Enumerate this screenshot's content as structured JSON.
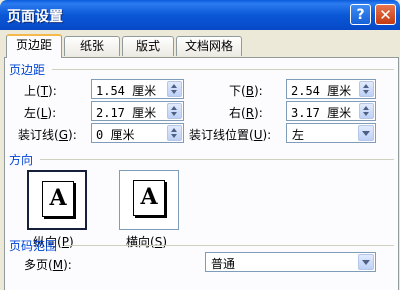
{
  "window": {
    "title": "页面设置",
    "help_label": "?",
    "close_label": "✕"
  },
  "tabs": [
    "页边距",
    "纸张",
    "版式",
    "文档网格"
  ],
  "margins": {
    "section_label": "页边距",
    "top": {
      "label": "上",
      "key": "T",
      "value": "1.54 厘米"
    },
    "bottom": {
      "label": "下",
      "key": "B",
      "value": "2.54 厘米"
    },
    "left": {
      "label": "左",
      "key": "L",
      "value": "2.17 厘米"
    },
    "right": {
      "label": "右",
      "key": "R",
      "value": "3.17 厘米"
    },
    "gutter": {
      "label": "装订线",
      "key": "G",
      "value": "0 厘米"
    },
    "gutter_pos": {
      "label": "装订线位置",
      "key": "U",
      "value": "左"
    }
  },
  "orientation": {
    "section_label": "方向",
    "portrait": {
      "label": "纵向",
      "key": "P",
      "glyph": "A"
    },
    "landscape": {
      "label": "横向",
      "key": "S",
      "glyph": "A"
    }
  },
  "pages": {
    "section_label": "页码范围",
    "multiple": {
      "label": "多页",
      "key": "M",
      "value": "普通"
    }
  },
  "colors": {
    "accent": "#0046d5",
    "titlebar": "#0a5bdc",
    "tab_highlight": "#f4b94a"
  }
}
